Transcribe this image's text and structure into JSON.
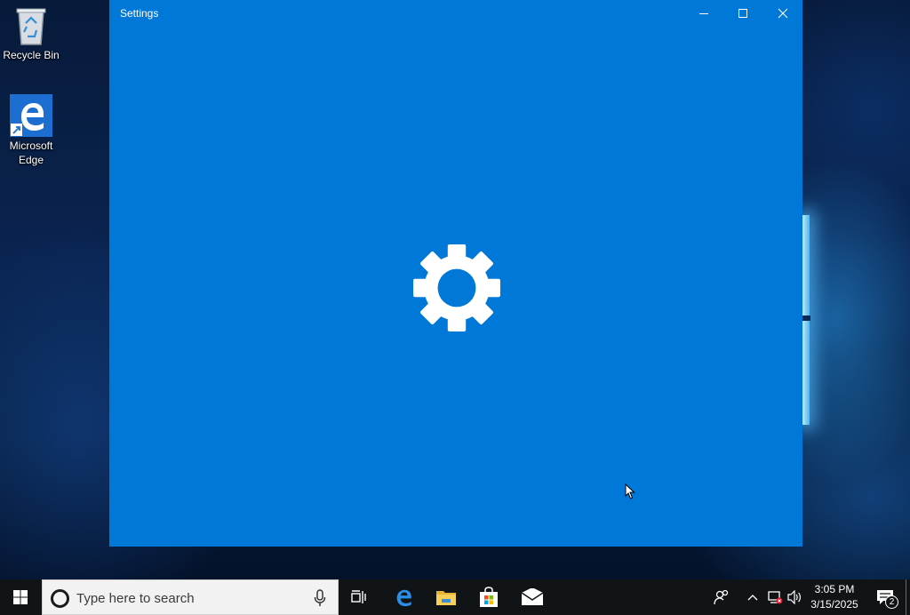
{
  "desktop": {
    "icons": [
      {
        "label": "Recycle Bin",
        "icon": "recycle-bin-icon"
      },
      {
        "label": "Microsoft Edge",
        "icon": "edge-icon"
      }
    ]
  },
  "window": {
    "title": "Settings",
    "accent": "#0078d7",
    "controls": {
      "minimize": "minimize-icon",
      "maximize": "maximize-icon",
      "close": "close-icon"
    },
    "splash_icon": "gear-icon"
  },
  "taskbar": {
    "background": "#101417",
    "search": {
      "placeholder": "Type here to search"
    },
    "pinned_apps": [
      "task-view-icon",
      "edge-icon",
      "file-explorer-icon",
      "store-icon",
      "mail-icon"
    ],
    "tray": {
      "time": "3:05 PM",
      "date": "3/15/2025",
      "notification_count": "2"
    }
  }
}
